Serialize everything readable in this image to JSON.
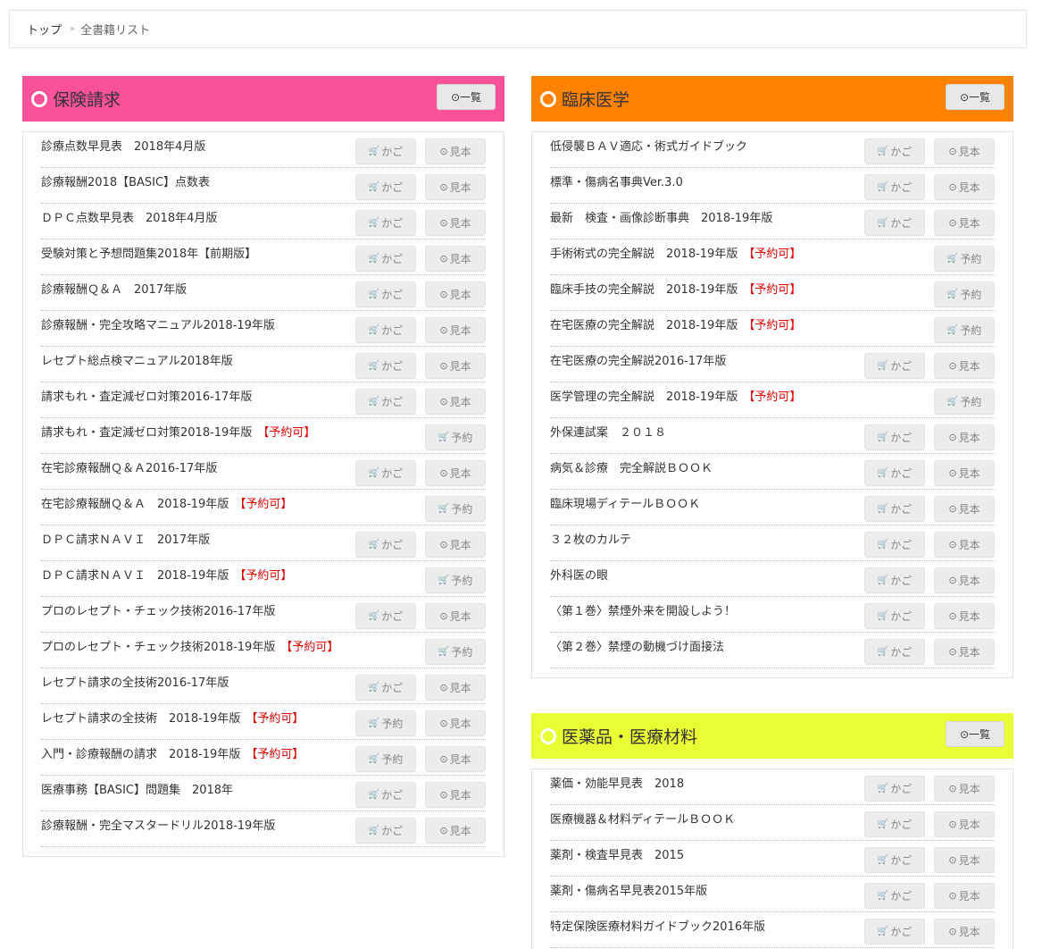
{
  "breadcrumb": {
    "home": "トップ",
    "sep": "»",
    "current": "全書籍リスト"
  },
  "colors": {
    "insurance": "#f9519a",
    "clinical": "#ff8200",
    "drugs": "#eaff33"
  },
  "icons": {
    "cart": "cart-icon",
    "circle_arrow": "circle-arrow-icon"
  },
  "panels": [
    {
      "key": "insurance",
      "title": "保険請求",
      "list_label": "⊙一覧",
      "books": [
        {
          "title": "診療点数早見表　2018年4月版",
          "badge": "",
          "b1": "かご",
          "b2": "見本"
        },
        {
          "title": "診療報酬2018【BASIC】点数表",
          "badge": "",
          "b1": "かご",
          "b2": "見本"
        },
        {
          "title": "ＤＰＣ点数早見表　2018年4月版",
          "badge": "",
          "b1": "かご",
          "b2": "見本"
        },
        {
          "title": "受験対策と予想問題集2018年【前期版】",
          "badge": "",
          "b1": "かご",
          "b2": "見本"
        },
        {
          "title": "診療報酬Ｑ＆Ａ　2017年版",
          "badge": "",
          "b1": "かご",
          "b2": "見本"
        },
        {
          "title": "診療報酬・完全攻略マニュアル2018-19年版",
          "badge": "",
          "b1": "かご",
          "b2": "見本"
        },
        {
          "title": "レセプト総点検マニュアル2018年版",
          "badge": "",
          "b1": "かご",
          "b2": "見本"
        },
        {
          "title": "請求もれ・査定減ゼロ対策2016-17年版",
          "badge": "",
          "b1": "かご",
          "b2": "見本"
        },
        {
          "title": "請求もれ・査定減ゼロ対策2018-19年版",
          "badge": "【予約可】",
          "b1": "",
          "b2": "予約"
        },
        {
          "title": "在宅診療報酬Ｑ＆Ａ2016-17年版",
          "badge": "",
          "b1": "かご",
          "b2": "見本"
        },
        {
          "title": "在宅診療報酬Ｑ＆Ａ　2018-19年版",
          "badge": "【予約可】",
          "b1": "",
          "b2": "予約"
        },
        {
          "title": "ＤＰＣ請求ＮＡＶＩ　2017年版",
          "badge": "",
          "b1": "かご",
          "b2": "見本"
        },
        {
          "title": "ＤＰＣ請求ＮＡＶＩ　2018-19年版",
          "badge": "【予約可】",
          "b1": "",
          "b2": "予約"
        },
        {
          "title": "プロのレセプト・チェック技術2016-17年版",
          "badge": "",
          "b1": "かご",
          "b2": "見本"
        },
        {
          "title": "プロのレセプト・チェック技術2018-19年版",
          "badge": "【予約可】",
          "b1": "",
          "b2": "予約"
        },
        {
          "title": "レセプト請求の全技術2016-17年版",
          "badge": "",
          "b1": "かご",
          "b2": "見本"
        },
        {
          "title": "レセプト請求の全技術　2018-19年版",
          "badge": "【予約可】",
          "b1": "予約",
          "b2": "見本"
        },
        {
          "title": "入門・診療報酬の請求　2018-19年版",
          "badge": "【予約可】",
          "b1": "予約",
          "b2": "見本"
        },
        {
          "title": "医療事務【BASIC】問題集　2018年",
          "badge": "",
          "b1": "かご",
          "b2": "見本"
        },
        {
          "title": "診療報酬・完全マスタードリル2018-19年版",
          "badge": "",
          "b1": "かご",
          "b2": "見本"
        }
      ]
    },
    {
      "key": "clinical",
      "title": "臨床医学",
      "list_label": "⊙一覧",
      "books": [
        {
          "title": "低侵襲ＢＡＶ適応・術式ガイドブック",
          "badge": "",
          "b1": "かご",
          "b2": "見本"
        },
        {
          "title": "標準・傷病名事典Ver.3.0",
          "badge": "",
          "b1": "かご",
          "b2": "見本"
        },
        {
          "title": "最新　検査・画像診断事典　2018-19年版",
          "badge": "",
          "b1": "かご",
          "b2": "見本"
        },
        {
          "title": "手術術式の完全解説　2018-19年版",
          "badge": "【予約可】",
          "b1": "",
          "b2": "予約"
        },
        {
          "title": "臨床手技の完全解説　2018-19年版",
          "badge": "【予約可】",
          "b1": "",
          "b2": "予約"
        },
        {
          "title": "在宅医療の完全解説　2018-19年版",
          "badge": "【予約可】",
          "b1": "",
          "b2": "予約"
        },
        {
          "title": "在宅医療の完全解説2016-17年版",
          "badge": "",
          "b1": "かご",
          "b2": "見本"
        },
        {
          "title": "医学管理の完全解説　2018-19年版",
          "badge": "【予約可】",
          "b1": "",
          "b2": "予約"
        },
        {
          "title": "外保連試案　２０１８",
          "badge": "",
          "b1": "かご",
          "b2": "見本"
        },
        {
          "title": "病気＆診療　完全解説ＢＯＯＫ",
          "badge": "",
          "b1": "かご",
          "b2": "見本"
        },
        {
          "title": "臨床現場ディテールＢＯＯＫ",
          "badge": "",
          "b1": "かご",
          "b2": "見本"
        },
        {
          "title": "３２枚のカルテ",
          "badge": "",
          "b1": "かご",
          "b2": "見本"
        },
        {
          "title": "外科医の眼",
          "badge": "",
          "b1": "かご",
          "b2": "見本"
        },
        {
          "title": "〈第１巻〉禁煙外来を開設しよう！",
          "badge": "",
          "b1": "かご",
          "b2": "見本"
        },
        {
          "title": "〈第２巻〉禁煙の動機づけ面接法",
          "badge": "",
          "b1": "かご",
          "b2": "見本"
        }
      ]
    },
    {
      "key": "drugs",
      "title": "医薬品・医療材料",
      "list_label": "⊙一覧",
      "books": [
        {
          "title": "薬価・効能早見表　2018",
          "badge": "",
          "b1": "かご",
          "b2": "見本"
        },
        {
          "title": "医療機器＆材料ディテールＢＯＯＫ",
          "badge": "",
          "b1": "かご",
          "b2": "見本"
        },
        {
          "title": "薬剤・検査早見表　2015",
          "badge": "",
          "b1": "かご",
          "b2": "見本"
        },
        {
          "title": "薬剤・傷病名早見表2015年版",
          "badge": "",
          "b1": "かご",
          "b2": "見本"
        },
        {
          "title": "特定保険医療材料ガイドブック2016年版",
          "badge": "",
          "b1": "かご",
          "b2": "見本"
        }
      ]
    }
  ]
}
